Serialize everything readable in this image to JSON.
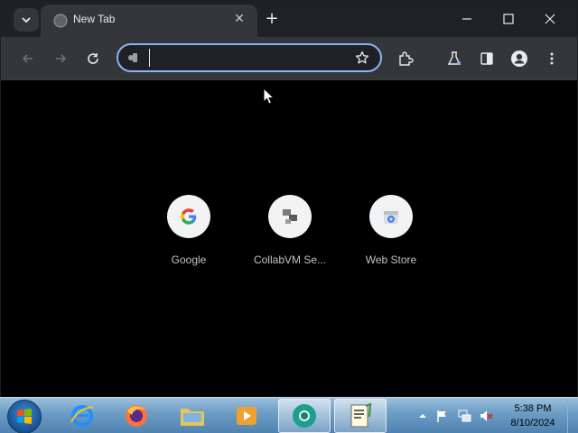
{
  "browser": {
    "tab": {
      "title": "New Tab",
      "close": "✕"
    },
    "new_tab": "+",
    "window_controls": {
      "minimize": "—",
      "maximize": "☐",
      "close": "✕"
    },
    "toolbar": {
      "omnibox_value": "",
      "icons": [
        "back-icon",
        "forward-icon",
        "reload-icon",
        "star-icon",
        "extensions-icon",
        "labs-icon",
        "side-panel-icon",
        "profile-icon",
        "menu-icon"
      ]
    },
    "shortcuts": [
      {
        "label": "Google",
        "icon": "google-icon"
      },
      {
        "label": "CollabVM Se...",
        "icon": "collabvm-icon"
      },
      {
        "label": "Web Store",
        "icon": "webstore-icon"
      }
    ]
  },
  "taskbar": {
    "apps": [
      "internet-explorer-icon",
      "firefox-icon",
      "file-explorer-icon",
      "media-player-icon",
      "chrome-icon",
      "notepad-icon"
    ],
    "clock": {
      "time": "5:38 PM",
      "date": "8/10/2024"
    }
  },
  "colors": {
    "titlebar": "#202124",
    "toolbar": "#35363a",
    "content": "#000000",
    "omnibox_border": "#8ab4f8"
  }
}
